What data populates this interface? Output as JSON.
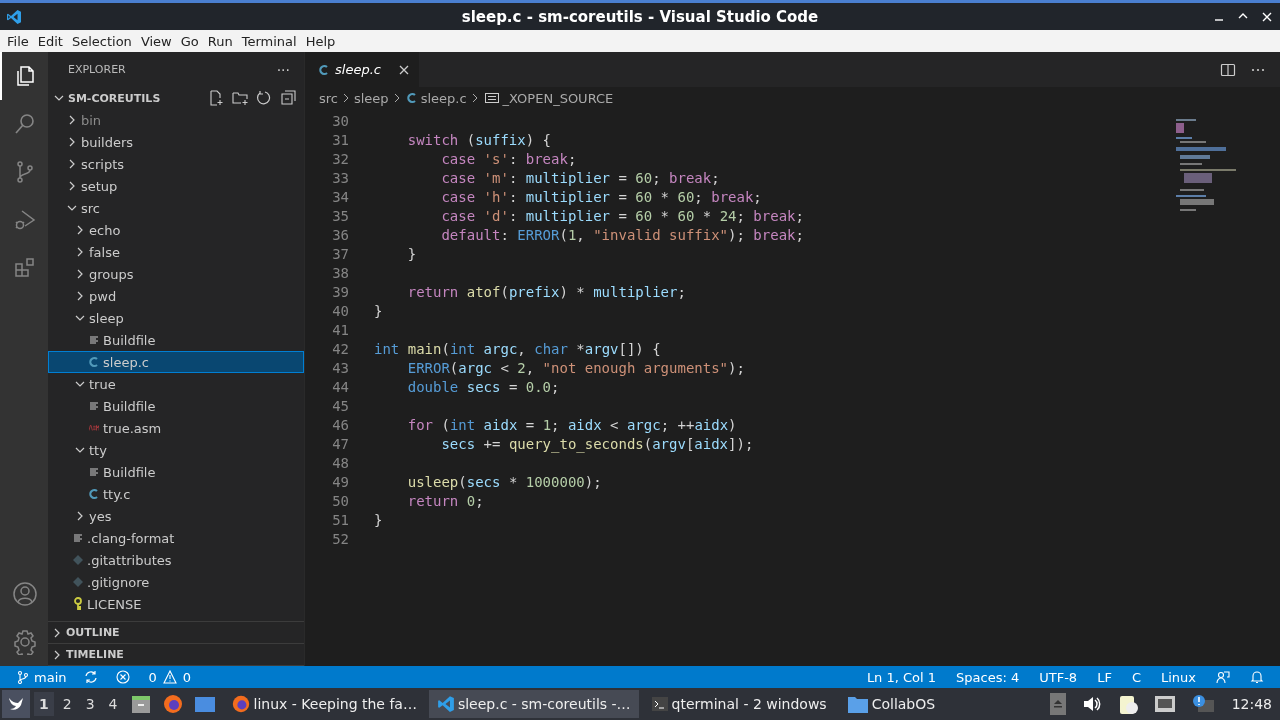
{
  "window": {
    "title": "sleep.c - sm-coreutils - Visual Studio Code"
  },
  "menu": [
    "File",
    "Edit",
    "Selection",
    "View",
    "Go",
    "Run",
    "Terminal",
    "Help"
  ],
  "activity_bar": [
    {
      "kind": "files",
      "selected": true
    },
    {
      "kind": "search",
      "selected": false
    },
    {
      "kind": "scm",
      "selected": false
    },
    {
      "kind": "debug",
      "selected": false
    },
    {
      "kind": "extensions",
      "selected": false
    }
  ],
  "explorer": {
    "title": "EXPLORER",
    "more": "···",
    "root": "SM-COREUTILS",
    "root_expanded": true,
    "tree": [
      {
        "name": "bin",
        "kind": "folder",
        "expanded": false,
        "dimmed": true,
        "selected": false
      },
      {
        "name": "builders",
        "kind": "folder",
        "expanded": false,
        "dimmed": false,
        "selected": false
      },
      {
        "name": "scripts",
        "kind": "folder",
        "expanded": false,
        "dimmed": false,
        "selected": false
      },
      {
        "name": "setup",
        "kind": "folder",
        "expanded": false,
        "dimmed": false,
        "selected": false
      },
      {
        "name": "src",
        "kind": "folder",
        "expanded": true,
        "dimmed": false,
        "selected": false,
        "children": [
          {
            "name": "echo",
            "kind": "folder",
            "expanded": false,
            "selected": false
          },
          {
            "name": "false",
            "kind": "folder",
            "expanded": false,
            "selected": false
          },
          {
            "name": "groups",
            "kind": "folder",
            "expanded": false,
            "selected": false
          },
          {
            "name": "pwd",
            "kind": "folder",
            "expanded": false,
            "selected": false
          },
          {
            "name": "sleep",
            "kind": "folder",
            "expanded": true,
            "selected": false,
            "children": [
              {
                "name": "Buildfile",
                "kind": "text",
                "selected": false
              },
              {
                "name": "sleep.c",
                "kind": "c",
                "selected": true
              }
            ]
          },
          {
            "name": "true",
            "kind": "folder",
            "expanded": true,
            "selected": false,
            "children": [
              {
                "name": "Buildfile",
                "kind": "text",
                "selected": false
              },
              {
                "name": "true.asm",
                "kind": "asm",
                "selected": false
              }
            ]
          },
          {
            "name": "tty",
            "kind": "folder",
            "expanded": true,
            "selected": false,
            "children": [
              {
                "name": "Buildfile",
                "kind": "text",
                "selected": false
              },
              {
                "name": "tty.c",
                "kind": "c",
                "selected": false
              }
            ]
          },
          {
            "name": "yes",
            "kind": "folder",
            "expanded": false,
            "selected": false
          }
        ]
      },
      {
        "name": ".clang-format",
        "kind": "text",
        "dimmed": false,
        "selected": false
      },
      {
        "name": ".gitattributes",
        "kind": "git",
        "dimmed": false,
        "selected": false
      },
      {
        "name": ".gitignore",
        "kind": "git",
        "dimmed": false,
        "selected": false
      },
      {
        "name": "LICENSE",
        "kind": "license",
        "dimmed": false,
        "selected": false
      }
    ],
    "sections": [
      {
        "title": "OUTLINE",
        "expanded": false
      },
      {
        "title": "TIMELINE",
        "expanded": false
      }
    ]
  },
  "tabs": [
    {
      "label": "sleep.c",
      "selected": true
    }
  ],
  "breadcrumbs": [
    "src",
    "sleep",
    "sleep.c",
    "_XOPEN_SOURCE"
  ],
  "code": [
    {
      "number": "30"
    },
    {
      "number": "31",
      "tokens": [
        {
          "text": "    switch",
          "kind": "control"
        },
        {
          "text": " (",
          "kind": "plain"
        },
        {
          "text": "suffix",
          "kind": "variable"
        },
        {
          "text": ") {",
          "kind": "plain"
        }
      ]
    },
    {
      "number": "32",
      "tokens": [
        {
          "text": "        case",
          "kind": "control"
        },
        {
          "text": " 's'",
          "kind": "string"
        },
        {
          "text": ": ",
          "kind": "plain"
        },
        {
          "text": "break",
          "kind": "control"
        },
        {
          "text": ";",
          "kind": "plain"
        }
      ]
    },
    {
      "number": "33",
      "tokens": [
        {
          "text": "        case",
          "kind": "control"
        },
        {
          "text": " 'm'",
          "kind": "string"
        },
        {
          "text": ": ",
          "kind": "plain"
        },
        {
          "text": "multiplier",
          "kind": "variable"
        },
        {
          "text": " = ",
          "kind": "plain"
        },
        {
          "text": "60",
          "kind": "number"
        },
        {
          "text": "; ",
          "kind": "plain"
        },
        {
          "text": "break",
          "kind": "control"
        },
        {
          "text": ";",
          "kind": "plain"
        }
      ]
    },
    {
      "number": "34",
      "tokens": [
        {
          "text": "        case",
          "kind": "control"
        },
        {
          "text": " 'h'",
          "kind": "string"
        },
        {
          "text": ": ",
          "kind": "plain"
        },
        {
          "text": "multiplier",
          "kind": "variable"
        },
        {
          "text": " = ",
          "kind": "plain"
        },
        {
          "text": "60",
          "kind": "number"
        },
        {
          "text": " * ",
          "kind": "plain"
        },
        {
          "text": "60",
          "kind": "number"
        },
        {
          "text": "; ",
          "kind": "plain"
        },
        {
          "text": "break",
          "kind": "control"
        },
        {
          "text": ";",
          "kind": "plain"
        }
      ]
    },
    {
      "number": "35",
      "tokens": [
        {
          "text": "        case",
          "kind": "control"
        },
        {
          "text": " 'd'",
          "kind": "string"
        },
        {
          "text": ": ",
          "kind": "plain"
        },
        {
          "text": "multiplier",
          "kind": "variable"
        },
        {
          "text": " = ",
          "kind": "plain"
        },
        {
          "text": "60",
          "kind": "number"
        },
        {
          "text": " * ",
          "kind": "plain"
        },
        {
          "text": "60",
          "kind": "number"
        },
        {
          "text": " * ",
          "kind": "plain"
        },
        {
          "text": "24",
          "kind": "number"
        },
        {
          "text": "; ",
          "kind": "plain"
        },
        {
          "text": "break",
          "kind": "control"
        },
        {
          "text": ";",
          "kind": "plain"
        }
      ]
    },
    {
      "number": "36",
      "tokens": [
        {
          "text": "        default",
          "kind": "control"
        },
        {
          "text": ": ",
          "kind": "plain"
        },
        {
          "text": "ERROR",
          "kind": "macro"
        },
        {
          "text": "(",
          "kind": "plain"
        },
        {
          "text": "1",
          "kind": "number"
        },
        {
          "text": ", ",
          "kind": "plain"
        },
        {
          "text": "\"invalid suffix\"",
          "kind": "string"
        },
        {
          "text": "); ",
          "kind": "plain"
        },
        {
          "text": "break",
          "kind": "control"
        },
        {
          "text": ";",
          "kind": "plain"
        }
      ]
    },
    {
      "number": "37",
      "tokens": [
        {
          "text": "    }",
          "kind": "plain"
        }
      ]
    },
    {
      "number": "38"
    },
    {
      "number": "39",
      "tokens": [
        {
          "text": "    return",
          "kind": "control"
        },
        {
          "text": " atof",
          "kind": "function"
        },
        {
          "text": "(",
          "kind": "plain"
        },
        {
          "text": "prefix",
          "kind": "variable"
        },
        {
          "text": ") * ",
          "kind": "plain"
        },
        {
          "text": "multiplier",
          "kind": "variable"
        },
        {
          "text": ";",
          "kind": "plain"
        }
      ]
    },
    {
      "number": "40",
      "tokens": [
        {
          "text": "}",
          "kind": "plain"
        }
      ]
    },
    {
      "number": "41"
    },
    {
      "number": "42",
      "tokens": [
        {
          "text": "int",
          "kind": "keyword"
        },
        {
          "text": " main",
          "kind": "function"
        },
        {
          "text": "(",
          "kind": "plain"
        },
        {
          "text": "int",
          "kind": "keyword"
        },
        {
          "text": " argc",
          "kind": "variable"
        },
        {
          "text": ", ",
          "kind": "plain"
        },
        {
          "text": "char",
          "kind": "keyword"
        },
        {
          "text": " *",
          "kind": "plain"
        },
        {
          "text": "argv",
          "kind": "variable"
        },
        {
          "text": "[]) {",
          "kind": "plain"
        }
      ]
    },
    {
      "number": "43",
      "tokens": [
        {
          "text": "    ERROR",
          "kind": "macro"
        },
        {
          "text": "(",
          "kind": "plain"
        },
        {
          "text": "argc",
          "kind": "variable"
        },
        {
          "text": " < ",
          "kind": "plain"
        },
        {
          "text": "2",
          "kind": "number"
        },
        {
          "text": ", ",
          "kind": "plain"
        },
        {
          "text": "\"not enough arguments\"",
          "kind": "string"
        },
        {
          "text": ");",
          "kind": "plain"
        }
      ]
    },
    {
      "number": "44",
      "tokens": [
        {
          "text": "    double",
          "kind": "keyword"
        },
        {
          "text": " secs",
          "kind": "variable"
        },
        {
          "text": " = ",
          "kind": "plain"
        },
        {
          "text": "0.0",
          "kind": "number"
        },
        {
          "text": ";",
          "kind": "plain"
        }
      ]
    },
    {
      "number": "45"
    },
    {
      "number": "46",
      "tokens": [
        {
          "text": "    for",
          "kind": "control"
        },
        {
          "text": " (",
          "kind": "plain"
        },
        {
          "text": "int",
          "kind": "keyword"
        },
        {
          "text": " aidx",
          "kind": "variable"
        },
        {
          "text": " = ",
          "kind": "plain"
        },
        {
          "text": "1",
          "kind": "number"
        },
        {
          "text": "; ",
          "kind": "plain"
        },
        {
          "text": "aidx",
          "kind": "variable"
        },
        {
          "text": " < ",
          "kind": "plain"
        },
        {
          "text": "argc",
          "kind": "variable"
        },
        {
          "text": "; ++",
          "kind": "plain"
        },
        {
          "text": "aidx",
          "kind": "variable"
        },
        {
          "text": ")",
          "kind": "plain"
        }
      ]
    },
    {
      "number": "47",
      "tokens": [
        {
          "text": "        secs",
          "kind": "variable"
        },
        {
          "text": " += ",
          "kind": "plain"
        },
        {
          "text": "query_to_seconds",
          "kind": "function"
        },
        {
          "text": "(",
          "kind": "plain"
        },
        {
          "text": "argv",
          "kind": "variable"
        },
        {
          "text": "[",
          "kind": "plain"
        },
        {
          "text": "aidx",
          "kind": "variable"
        },
        {
          "text": "]);",
          "kind": "plain"
        }
      ]
    },
    {
      "number": "48"
    },
    {
      "number": "49",
      "tokens": [
        {
          "text": "    usleep",
          "kind": "function"
        },
        {
          "text": "(",
          "kind": "plain"
        },
        {
          "text": "secs",
          "kind": "variable"
        },
        {
          "text": " * ",
          "kind": "plain"
        },
        {
          "text": "1000000",
          "kind": "number"
        },
        {
          "text": ");",
          "kind": "plain"
        }
      ]
    },
    {
      "number": "50",
      "tokens": [
        {
          "text": "    return",
          "kind": "control"
        },
        {
          "text": " 0",
          "kind": "number"
        },
        {
          "text": ";",
          "kind": "plain"
        }
      ]
    },
    {
      "number": "51",
      "tokens": [
        {
          "text": "}",
          "kind": "plain"
        }
      ]
    },
    {
      "number": "52"
    }
  ],
  "status_bar": {
    "branch": "main",
    "errors": "0",
    "warnings": "0",
    "right": [
      "Ln 1, Col 1",
      "Spaces: 4",
      "UTF-8",
      "LF",
      "C",
      "Linux"
    ]
  },
  "taskbar": {
    "workspaces": [
      {
        "label": "1",
        "selected": true
      },
      {
        "label": "2",
        "selected": false
      },
      {
        "label": "3",
        "selected": false
      },
      {
        "label": "4",
        "selected": false
      }
    ],
    "tasks": [
      {
        "label": "linux - Keeping the fa…",
        "kind": "firefox",
        "selected": false
      },
      {
        "label": "sleep.c - sm-coreutils -…",
        "kind": "vscode",
        "selected": true
      },
      {
        "label": "qterminal - 2 windows",
        "kind": "terminal",
        "selected": false
      },
      {
        "label": "CollabOS",
        "kind": "folder",
        "selected": false
      }
    ],
    "clock": "12:48"
  }
}
